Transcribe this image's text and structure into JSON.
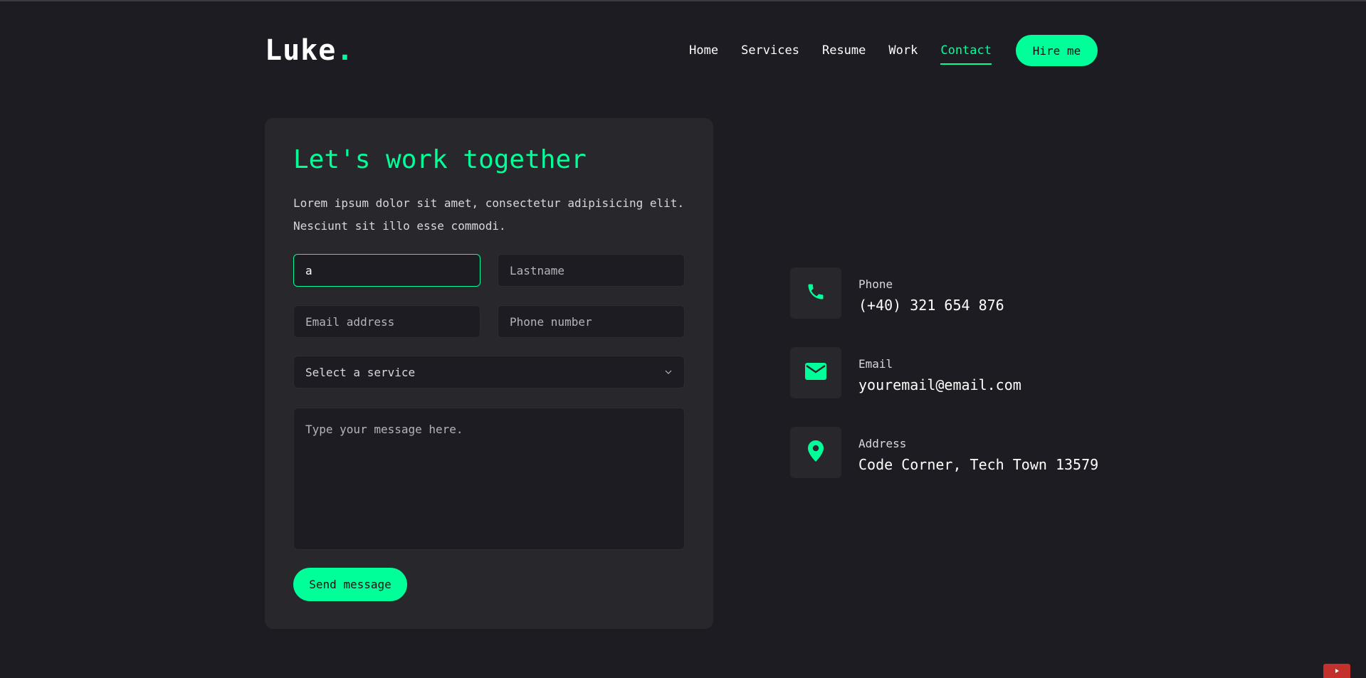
{
  "logo": {
    "text": "Luke",
    "dot": "."
  },
  "nav": {
    "items": [
      {
        "label": "Home"
      },
      {
        "label": "Services"
      },
      {
        "label": "Resume"
      },
      {
        "label": "Work"
      },
      {
        "label": "Contact",
        "active": true
      }
    ],
    "hire_label": "Hire me"
  },
  "form": {
    "title": "Let's work together",
    "description": "Lorem ipsum dolor sit amet, consectetur adipisicing elit. Nesciunt sit illo esse commodi.",
    "firstname_value": "a",
    "lastname_placeholder": "Lastname",
    "email_placeholder": "Email address",
    "phone_placeholder": "Phone number",
    "service_placeholder": "Select a service",
    "message_placeholder": "Type your message here.",
    "send_label": "Send message"
  },
  "info": [
    {
      "icon": "phone-icon",
      "label": "Phone",
      "value": "(+40) 321 654 876"
    },
    {
      "icon": "envelope-icon",
      "label": "Email",
      "value": "youremail@email.com"
    },
    {
      "icon": "map-pin-icon",
      "label": "Address",
      "value": "Code Corner, Tech Town 13579"
    }
  ],
  "colors": {
    "accent": "#00ff99",
    "background": "#1c1c22",
    "card": "#27272c"
  }
}
